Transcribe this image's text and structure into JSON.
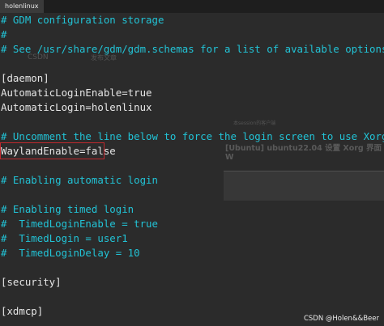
{
  "window": {
    "tab_title": "holenlinux"
  },
  "terminal": {
    "lines": [
      {
        "text": "# GDM configuration storage",
        "kind": "comment"
      },
      {
        "text": "#",
        "kind": "comment"
      },
      {
        "text": "# See /usr/share/gdm/gdm.schemas for a list of available options.",
        "kind": "comment"
      },
      {
        "text": "",
        "kind": "plain"
      },
      {
        "text": "[daemon]",
        "kind": "plain"
      },
      {
        "text": "AutomaticLoginEnable=true",
        "kind": "plain"
      },
      {
        "text": "AutomaticLogin=holenlinux",
        "kind": "plain"
      },
      {
        "text": "",
        "kind": "plain"
      },
      {
        "text": "# Uncomment the line below to force the login screen to use Xorg",
        "kind": "comment"
      },
      {
        "text": "WaylandEnable=false",
        "kind": "plain"
      },
      {
        "text": "",
        "kind": "plain"
      },
      {
        "text": "# Enabling automatic login",
        "kind": "comment"
      },
      {
        "text": "",
        "kind": "plain"
      },
      {
        "text": "# Enabling timed login",
        "kind": "comment"
      },
      {
        "text": "#  TimedLoginEnable = true",
        "kind": "comment"
      },
      {
        "text": "#  TimedLogin = user1",
        "kind": "comment"
      },
      {
        "text": "#  TimedLoginDelay = 10",
        "kind": "comment"
      },
      {
        "text": "",
        "kind": "plain"
      },
      {
        "text": "[security]",
        "kind": "plain"
      },
      {
        "text": "",
        "kind": "plain"
      },
      {
        "text": "[xdmcp]",
        "kind": "plain"
      }
    ]
  },
  "background_page": {
    "logo": "CSDN",
    "write_label": "发布文章",
    "headline": "[Ubuntu] ubuntu22.04 设置 Xorg 界面 W",
    "crumb": "本session的客户端"
  },
  "watermark": "CSDN @Holen&&Beer",
  "colors": {
    "comment": "#22c3d6",
    "text": "#e6e6e6",
    "highlight_border": "#c0282d",
    "background": "#2b2b2b"
  }
}
